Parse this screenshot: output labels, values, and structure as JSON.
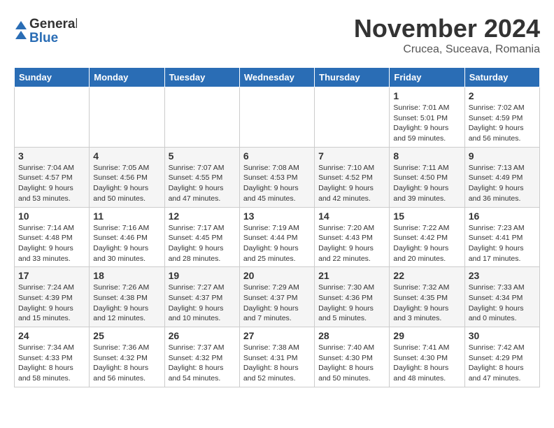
{
  "header": {
    "logo_general": "General",
    "logo_blue": "Blue",
    "month_title": "November 2024",
    "location": "Crucea, Suceava, Romania"
  },
  "weekdays": [
    "Sunday",
    "Monday",
    "Tuesday",
    "Wednesday",
    "Thursday",
    "Friday",
    "Saturday"
  ],
  "weeks": [
    [
      {
        "day": "",
        "sunrise": "",
        "sunset": "",
        "daylight": ""
      },
      {
        "day": "",
        "sunrise": "",
        "sunset": "",
        "daylight": ""
      },
      {
        "day": "",
        "sunrise": "",
        "sunset": "",
        "daylight": ""
      },
      {
        "day": "",
        "sunrise": "",
        "sunset": "",
        "daylight": ""
      },
      {
        "day": "",
        "sunrise": "",
        "sunset": "",
        "daylight": ""
      },
      {
        "day": "1",
        "sunrise": "Sunrise: 7:01 AM",
        "sunset": "Sunset: 5:01 PM",
        "daylight": "Daylight: 9 hours and 59 minutes."
      },
      {
        "day": "2",
        "sunrise": "Sunrise: 7:02 AM",
        "sunset": "Sunset: 4:59 PM",
        "daylight": "Daylight: 9 hours and 56 minutes."
      }
    ],
    [
      {
        "day": "3",
        "sunrise": "Sunrise: 7:04 AM",
        "sunset": "Sunset: 4:57 PM",
        "daylight": "Daylight: 9 hours and 53 minutes."
      },
      {
        "day": "4",
        "sunrise": "Sunrise: 7:05 AM",
        "sunset": "Sunset: 4:56 PM",
        "daylight": "Daylight: 9 hours and 50 minutes."
      },
      {
        "day": "5",
        "sunrise": "Sunrise: 7:07 AM",
        "sunset": "Sunset: 4:55 PM",
        "daylight": "Daylight: 9 hours and 47 minutes."
      },
      {
        "day": "6",
        "sunrise": "Sunrise: 7:08 AM",
        "sunset": "Sunset: 4:53 PM",
        "daylight": "Daylight: 9 hours and 45 minutes."
      },
      {
        "day": "7",
        "sunrise": "Sunrise: 7:10 AM",
        "sunset": "Sunset: 4:52 PM",
        "daylight": "Daylight: 9 hours and 42 minutes."
      },
      {
        "day": "8",
        "sunrise": "Sunrise: 7:11 AM",
        "sunset": "Sunset: 4:50 PM",
        "daylight": "Daylight: 9 hours and 39 minutes."
      },
      {
        "day": "9",
        "sunrise": "Sunrise: 7:13 AM",
        "sunset": "Sunset: 4:49 PM",
        "daylight": "Daylight: 9 hours and 36 minutes."
      }
    ],
    [
      {
        "day": "10",
        "sunrise": "Sunrise: 7:14 AM",
        "sunset": "Sunset: 4:48 PM",
        "daylight": "Daylight: 9 hours and 33 minutes."
      },
      {
        "day": "11",
        "sunrise": "Sunrise: 7:16 AM",
        "sunset": "Sunset: 4:46 PM",
        "daylight": "Daylight: 9 hours and 30 minutes."
      },
      {
        "day": "12",
        "sunrise": "Sunrise: 7:17 AM",
        "sunset": "Sunset: 4:45 PM",
        "daylight": "Daylight: 9 hours and 28 minutes."
      },
      {
        "day": "13",
        "sunrise": "Sunrise: 7:19 AM",
        "sunset": "Sunset: 4:44 PM",
        "daylight": "Daylight: 9 hours and 25 minutes."
      },
      {
        "day": "14",
        "sunrise": "Sunrise: 7:20 AM",
        "sunset": "Sunset: 4:43 PM",
        "daylight": "Daylight: 9 hours and 22 minutes."
      },
      {
        "day": "15",
        "sunrise": "Sunrise: 7:22 AM",
        "sunset": "Sunset: 4:42 PM",
        "daylight": "Daylight: 9 hours and 20 minutes."
      },
      {
        "day": "16",
        "sunrise": "Sunrise: 7:23 AM",
        "sunset": "Sunset: 4:41 PM",
        "daylight": "Daylight: 9 hours and 17 minutes."
      }
    ],
    [
      {
        "day": "17",
        "sunrise": "Sunrise: 7:24 AM",
        "sunset": "Sunset: 4:39 PM",
        "daylight": "Daylight: 9 hours and 15 minutes."
      },
      {
        "day": "18",
        "sunrise": "Sunrise: 7:26 AM",
        "sunset": "Sunset: 4:38 PM",
        "daylight": "Daylight: 9 hours and 12 minutes."
      },
      {
        "day": "19",
        "sunrise": "Sunrise: 7:27 AM",
        "sunset": "Sunset: 4:37 PM",
        "daylight": "Daylight: 9 hours and 10 minutes."
      },
      {
        "day": "20",
        "sunrise": "Sunrise: 7:29 AM",
        "sunset": "Sunset: 4:37 PM",
        "daylight": "Daylight: 9 hours and 7 minutes."
      },
      {
        "day": "21",
        "sunrise": "Sunrise: 7:30 AM",
        "sunset": "Sunset: 4:36 PM",
        "daylight": "Daylight: 9 hours and 5 minutes."
      },
      {
        "day": "22",
        "sunrise": "Sunrise: 7:32 AM",
        "sunset": "Sunset: 4:35 PM",
        "daylight": "Daylight: 9 hours and 3 minutes."
      },
      {
        "day": "23",
        "sunrise": "Sunrise: 7:33 AM",
        "sunset": "Sunset: 4:34 PM",
        "daylight": "Daylight: 9 hours and 0 minutes."
      }
    ],
    [
      {
        "day": "24",
        "sunrise": "Sunrise: 7:34 AM",
        "sunset": "Sunset: 4:33 PM",
        "daylight": "Daylight: 8 hours and 58 minutes."
      },
      {
        "day": "25",
        "sunrise": "Sunrise: 7:36 AM",
        "sunset": "Sunset: 4:32 PM",
        "daylight": "Daylight: 8 hours and 56 minutes."
      },
      {
        "day": "26",
        "sunrise": "Sunrise: 7:37 AM",
        "sunset": "Sunset: 4:32 PM",
        "daylight": "Daylight: 8 hours and 54 minutes."
      },
      {
        "day": "27",
        "sunrise": "Sunrise: 7:38 AM",
        "sunset": "Sunset: 4:31 PM",
        "daylight": "Daylight: 8 hours and 52 minutes."
      },
      {
        "day": "28",
        "sunrise": "Sunrise: 7:40 AM",
        "sunset": "Sunset: 4:30 PM",
        "daylight": "Daylight: 8 hours and 50 minutes."
      },
      {
        "day": "29",
        "sunrise": "Sunrise: 7:41 AM",
        "sunset": "Sunset: 4:30 PM",
        "daylight": "Daylight: 8 hours and 48 minutes."
      },
      {
        "day": "30",
        "sunrise": "Sunrise: 7:42 AM",
        "sunset": "Sunset: 4:29 PM",
        "daylight": "Daylight: 8 hours and 47 minutes."
      }
    ]
  ]
}
